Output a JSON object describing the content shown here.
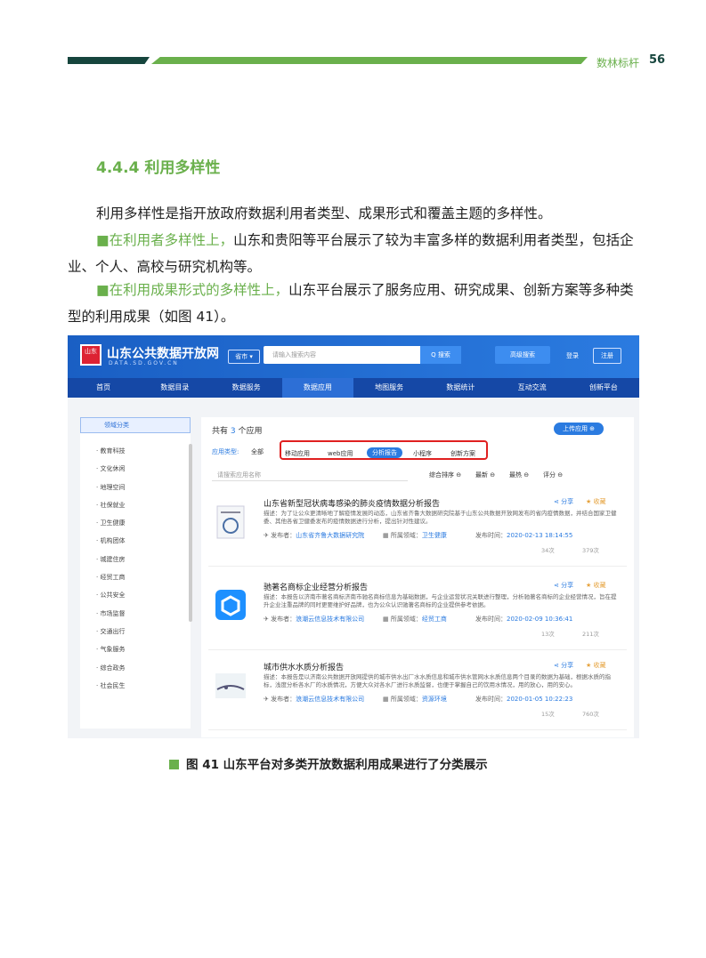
{
  "header": {
    "brand": "数林标杆",
    "page_number": "56"
  },
  "section": {
    "title": "4.4.4 利用多样性"
  },
  "paragraphs": {
    "p1": "利用多样性是指开放政府数据利用者类型、成果形式和覆盖主题的多样性。",
    "p2_highlight": "■在利用者多样性上，",
    "p2_text": "山东和贵阳等平台展示了较为丰富多样的数据利用者类型，包括企业、个人、高校与研究机构等。",
    "p3_highlight": "■在利用成果形式的多样性上，",
    "p3_text": "山东平台展示了服务应用、研究成果、创新方案等多种类型的利用成果（如图 41）。"
  },
  "screenshot": {
    "logo_text": "山东",
    "site_title": "山东公共数据开放网",
    "site_sub": "DATA.SD.GOV.CN",
    "province": "省市 ▾",
    "search_placeholder": "请输入搜索内容",
    "search_button": "Q 搜索",
    "advanced_search": "高级搜索",
    "login": "登录",
    "register": "注册",
    "nav": [
      "首页",
      "数据目录",
      "数据服务",
      "数据应用",
      "地图服务",
      "数据统计",
      "互动交流",
      "创新平台"
    ],
    "sidebar": {
      "header": "领域分类",
      "items": [
        "教育科技",
        "文化休闲",
        "地理空间",
        "社保就业",
        "卫生健康",
        "机构团体",
        "城建住房",
        "经贸工商",
        "公共安全",
        "市场监督",
        "交通出行",
        "气象服务",
        "综合政务",
        "社会民生"
      ]
    },
    "main": {
      "count_prefix": "共有",
      "count_value": "3",
      "count_suffix": "个应用",
      "upload_button": "上传应用 ⊕",
      "types_label": "应用类型:",
      "type_all": "全部",
      "types": [
        "移动应用",
        "web应用",
        "分析报告",
        "小程序",
        "创新方案"
      ],
      "filter_placeholder": "请搜索应用名称",
      "sorts": [
        "综合排序 ⊖",
        "最新 ⊖",
        "最热 ⊖",
        "评分 ⊖"
      ],
      "items": [
        {
          "title": "山东省新型冠状病毒感染的肺炎疫情数据分析报告",
          "share": "分享",
          "fav": "收藏",
          "desc": "描述：为了让公众更清晰地了解疫情发展的动态，山东省齐鲁大数据研究院基于山东公共数据开放网发布的省内疫情数据，并结合国家卫健委、其他各省卫健委发布的疫情数据进行分析，提出针对性建议。",
          "publisher_label": "发布者：",
          "publisher": "山东省齐鲁大数据研究院",
          "field_label": "所属领域：",
          "field": "卫生健康",
          "time_label": "发布时间：",
          "time": "2020-02-13 18:14:55",
          "views": "34次",
          "downloads": "379次"
        },
        {
          "title": "驰著名商标企业经营分析报告",
          "share": "分享",
          "fav": "收藏",
          "desc": "描述：本报告以济南市著名商标济南市驰名商标信息为基础数据，与企业运营状况关联进行整理，分析驰著名商标的企业经营情况，旨在提升企业注重品牌的同时更要维护好品牌，也为公众认识驰著名商标的企业提供参考依据。",
          "publisher_label": "发布者：",
          "publisher": "浪潮云信息技术有限公司",
          "field_label": "所属领域：",
          "field": "经贸工商",
          "time_label": "发布时间：",
          "time": "2020-02-09 10:36:41",
          "views": "13次",
          "downloads": "211次"
        },
        {
          "title": "城市供水水质分析报告",
          "share": "分享",
          "fav": "收藏",
          "desc": "描述：本报告是以济南公共数据开放网提供的城市供水出厂水水质信息和城市供水管网水水质信息两个目录的数据为基础，根据水质的指标，浅度分析各水厂的水质情况，方便大众对各水厂进行水质监督，也便于掌握自己的饮用水情况，用的放心，用的安心。",
          "publisher_label": "发布者：",
          "publisher": "浪潮云信息技术有限公司",
          "field_label": "所属领域：",
          "field": "资源环境",
          "time_label": "发布时间：",
          "time": "2020-01-05 10:22:23",
          "views": "15次",
          "downloads": "760次"
        }
      ]
    }
  },
  "caption": "图 41 山东平台对多类开放数据利用成果进行了分类展示",
  "colors": {
    "green": "#6ab04c",
    "dark_green": "#16453d",
    "blue": "#2b7be0"
  }
}
